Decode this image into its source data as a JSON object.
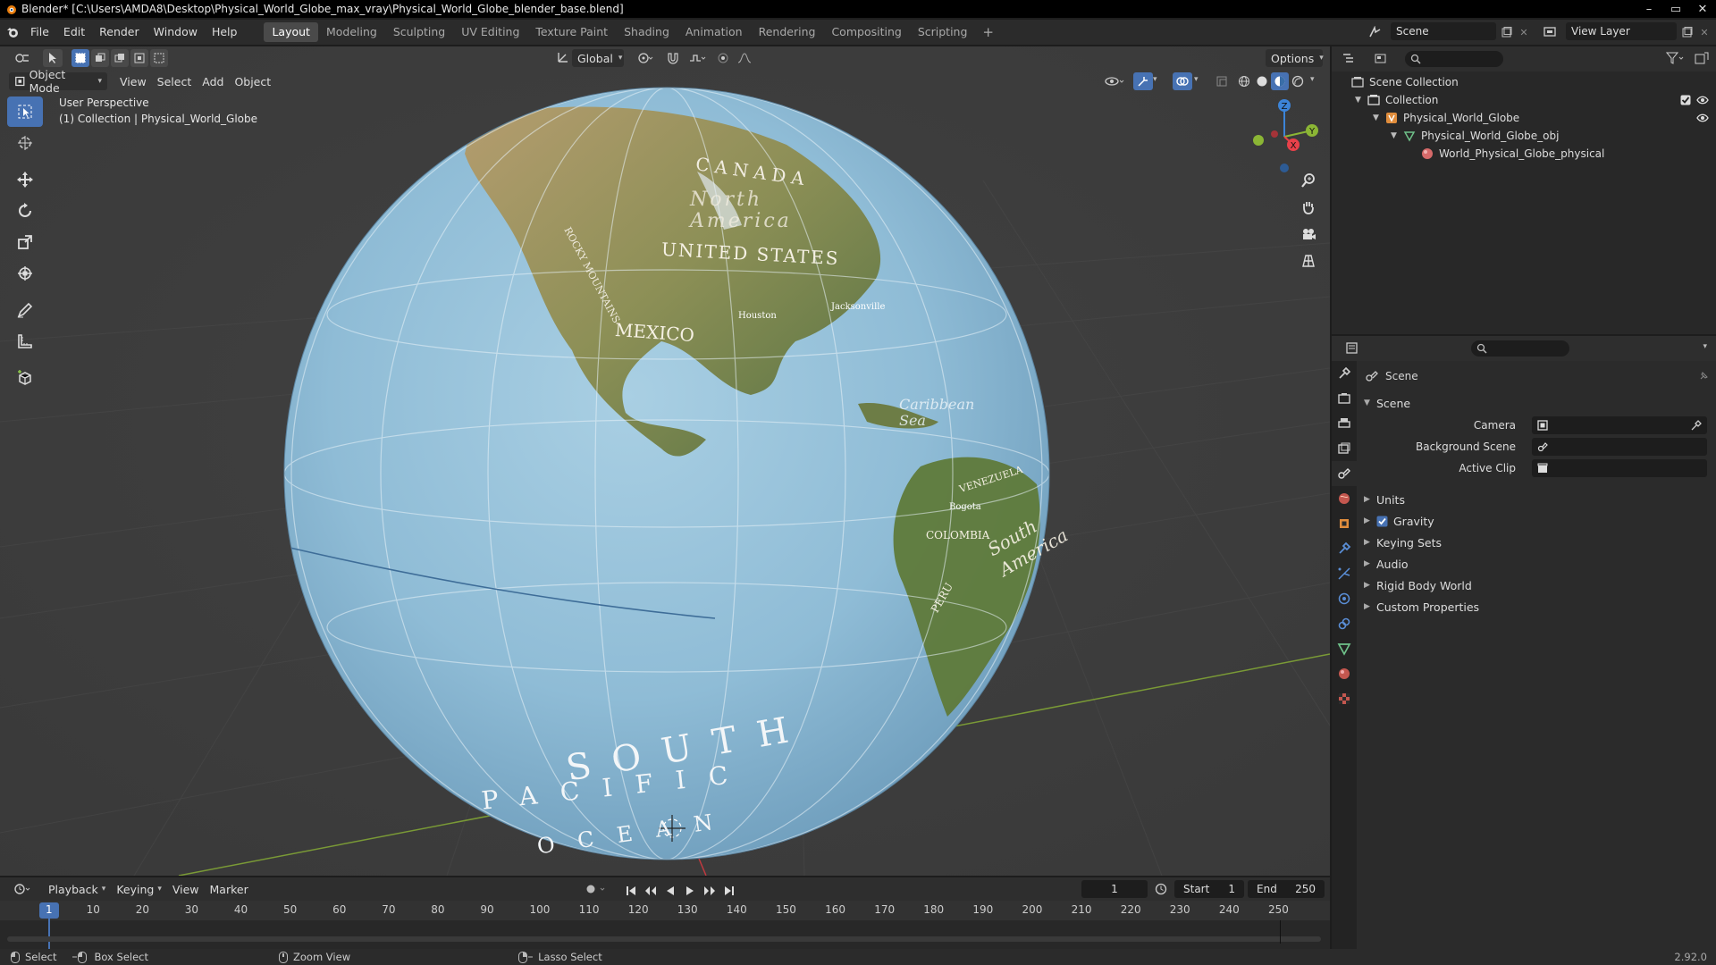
{
  "window": {
    "title": "Blender* [C:\\Users\\AMDA8\\Desktop\\Physical_World_Globe_max_vray\\Physical_World_Globe_blender_base.blend]",
    "minimize": "–",
    "maximize": "▭",
    "close": "✕"
  },
  "menu": {
    "items": [
      "File",
      "Edit",
      "Render",
      "Window",
      "Help"
    ]
  },
  "workspaces": {
    "tabs": [
      "Layout",
      "Modeling",
      "Sculpting",
      "UV Editing",
      "Texture Paint",
      "Shading",
      "Animation",
      "Rendering",
      "Compositing",
      "Scripting"
    ],
    "active": "Layout",
    "add": "+"
  },
  "topright": {
    "scene": "Scene",
    "view_layer": "View Layer"
  },
  "viewport": {
    "transform_orientation": "Global",
    "options_label": "Options",
    "mode": "Object Mode",
    "header_menus": [
      "View",
      "Select",
      "Add",
      "Object"
    ],
    "overlay_title": "User Perspective",
    "overlay_subtitle": "(1) Collection | Physical_World_Globe",
    "axis_labels": {
      "x": "X",
      "y": "Y",
      "z": "Z"
    },
    "globe_labels": {
      "canada": "CANADA",
      "north_america": "North America",
      "united_states": "UNITED STATES",
      "mexico": "MEXICO",
      "caribbean": "Caribbean Sea",
      "south_america": "South America",
      "south": "SOUTH",
      "pacific": "PACIFIC",
      "ocean": "OCEAN",
      "rocky": "ROCKY MOUNTAINS",
      "venezuela": "VENEZUELA",
      "colombia": "COLOMBIA",
      "peru": "PERU",
      "houston": "Houston",
      "jacksonville": "Jacksonville",
      "bogota": "Bogota"
    }
  },
  "outliner": {
    "rows": [
      {
        "label": "Scene Collection",
        "indent": 0
      },
      {
        "label": "Collection",
        "indent": 1
      },
      {
        "label": "Physical_World_Globe",
        "indent": 2
      },
      {
        "label": "Physical_World_Globe_obj",
        "indent": 3
      },
      {
        "label": "World_Physical_Globe_physical",
        "indent": 4
      }
    ]
  },
  "properties": {
    "context": "Scene",
    "panel": "Scene",
    "fields": [
      {
        "label": "Camera"
      },
      {
        "label": "Background Scene"
      },
      {
        "label": "Active Clip"
      }
    ],
    "subpanels": [
      "Units",
      "Gravity",
      "Keying Sets",
      "Audio",
      "Rigid Body World",
      "Custom Properties"
    ],
    "gravity_checked": true
  },
  "timeline": {
    "menus": [
      "Playback",
      "Keying",
      "View",
      "Marker"
    ],
    "current_frame": "1",
    "start_label": "Start",
    "start": "1",
    "end_label": "End",
    "end": "250",
    "ruler": [
      "1",
      "10",
      "20",
      "30",
      "40",
      "50",
      "60",
      "70",
      "80",
      "90",
      "100",
      "110",
      "120",
      "130",
      "140",
      "150",
      "160",
      "170",
      "180",
      "190",
      "200",
      "210",
      "220",
      "230",
      "240",
      "250"
    ]
  },
  "statusbar": {
    "select": "Select",
    "box_select": "Box Select",
    "zoom_view": "Zoom View",
    "lasso_select": "Lasso Select",
    "version": "2.92.0"
  },
  "colors": {
    "accent": "#4772b3",
    "x_axis": "#e8414a",
    "y_axis": "#8bb635",
    "z_axis": "#3c84d8"
  }
}
